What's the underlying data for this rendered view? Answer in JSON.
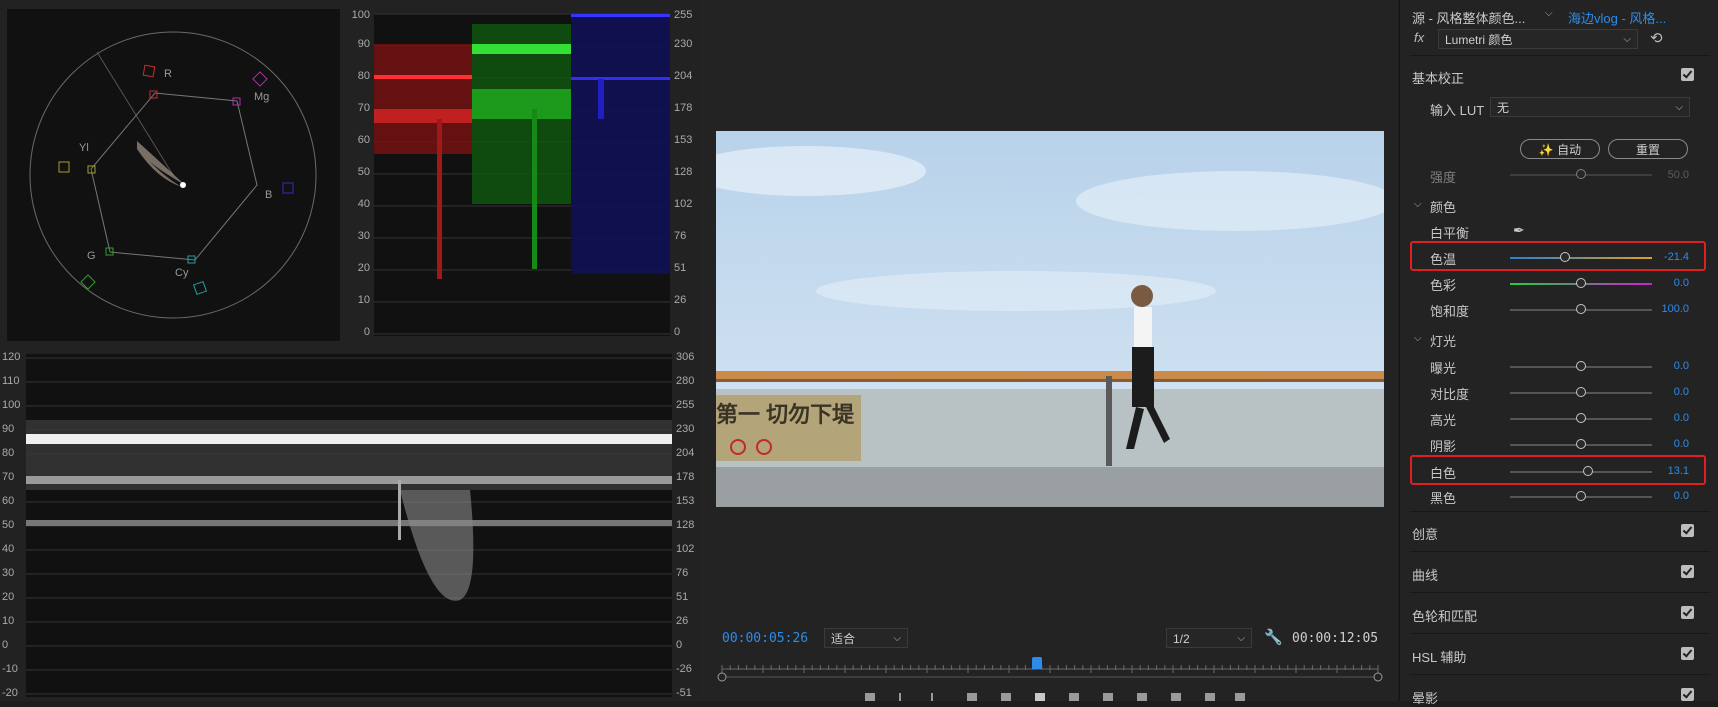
{
  "scopes": {
    "vector_labels": [
      "R",
      "Mg",
      "B",
      "Cy",
      "G",
      "Yl"
    ],
    "parade_ticks_left": [
      "100",
      "90",
      "80",
      "70",
      "60",
      "50",
      "40",
      "30",
      "20",
      "10",
      "0"
    ],
    "parade_ticks_right": [
      "255",
      "230",
      "204",
      "178",
      "153",
      "128",
      "102",
      "76",
      "51",
      "26",
      "0"
    ],
    "wave_ticks_left": [
      "120",
      "110",
      "100",
      "90",
      "80",
      "70",
      "60",
      "50",
      "40",
      "30",
      "20",
      "10",
      "0",
      "-10",
      "-20"
    ],
    "wave_ticks_right": [
      "306",
      "280",
      "255",
      "230",
      "204",
      "178",
      "153",
      "128",
      "102",
      "76",
      "51",
      "26",
      "0",
      "-26",
      "-51"
    ]
  },
  "monitor": {
    "timecode_current": "00:00:05:26",
    "fit_label": "适合",
    "resolution_label": "1/2",
    "timecode_total": "00:00:12:05",
    "playhead_fraction": 0.48,
    "sign_text": "第一 切勿下堤"
  },
  "lumetri": {
    "source_label": "源 - 风格整体颜色...",
    "sequence_label": "海边vlog - 风格...",
    "fx_label": "fx",
    "effect_label": "Lumetri 颜色",
    "basic_section": "基本校正",
    "input_lut_label": "输入 LUT",
    "input_lut_value": "无",
    "auto_label": "自动",
    "reset_label": "重置",
    "intensity_label": "强度",
    "intensity_value": "50.0",
    "color_section": "颜色",
    "white_balance_label": "白平衡",
    "temperature_label": "色温",
    "temperature_value": "-21.4",
    "tint_label": "色彩",
    "tint_value": "0.0",
    "saturation_label": "饱和度",
    "saturation_value": "100.0",
    "light_section": "灯光",
    "exposure_label": "曝光",
    "exposure_value": "0.0",
    "contrast_label": "对比度",
    "contrast_value": "0.0",
    "highlights_label": "高光",
    "highlights_value": "0.0",
    "shadows_label": "阴影",
    "shadows_value": "0.0",
    "whites_label": "白色",
    "whites_value": "13.1",
    "blacks_label": "黑色",
    "blacks_value": "0.0",
    "creative_section": "创意",
    "curves_section": "曲线",
    "wheels_section": "色轮和匹配",
    "hsl_section": "HSL 辅助",
    "vignette_section": "晕影",
    "accent": "#2d8ceb",
    "highlight_color": "#e02020"
  }
}
